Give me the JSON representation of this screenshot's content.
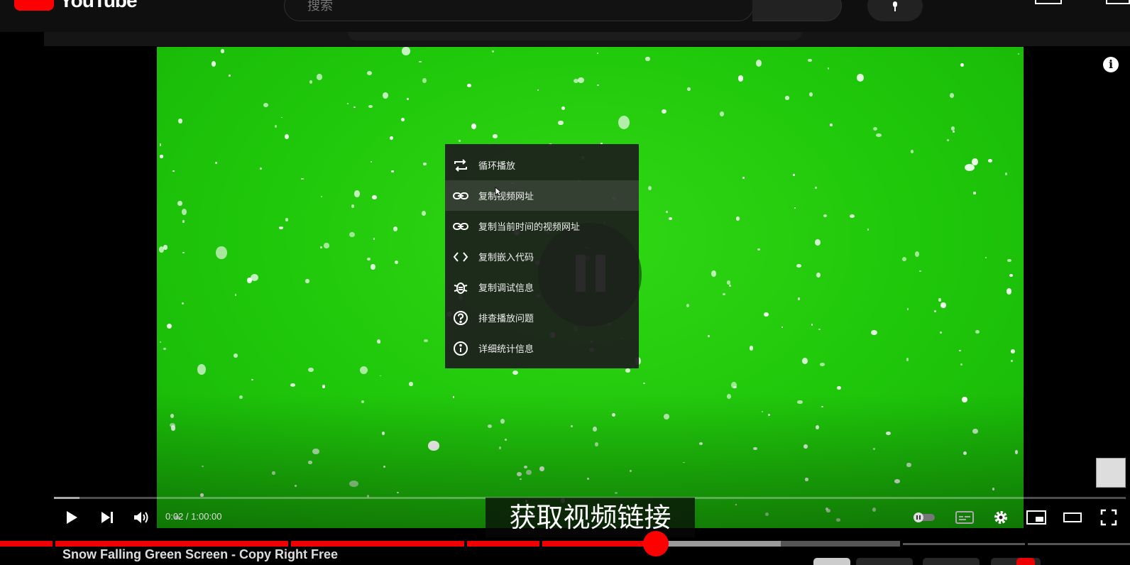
{
  "header": {
    "logo_text": "YouTube",
    "search_placeholder": "搜索"
  },
  "player": {
    "time_display": "0:02 / 1:00:00",
    "progress_fraction": 0.0006,
    "subtitle_text": "获取视频链接",
    "overlay_state": "paused"
  },
  "context_menu": {
    "items": [
      {
        "label": "循环播放",
        "icon": "loop-icon"
      },
      {
        "label": "复制视频网址",
        "icon": "link-icon"
      },
      {
        "label": "复制当前时间的视频网址",
        "icon": "link-icon"
      },
      {
        "label": "复制嵌入代码",
        "icon": "code-icon"
      },
      {
        "label": "复制调试信息",
        "icon": "bug-icon"
      },
      {
        "label": "排查播放问题",
        "icon": "help-icon"
      },
      {
        "label": "详细统计信息",
        "icon": "info-icon"
      }
    ],
    "hovered_index": 1
  },
  "video": {
    "title": "Snow Falling Green Screen - Copy Right Free"
  },
  "colors": {
    "brand_red": "#ff0000",
    "green_screen": "#22cc0c"
  }
}
